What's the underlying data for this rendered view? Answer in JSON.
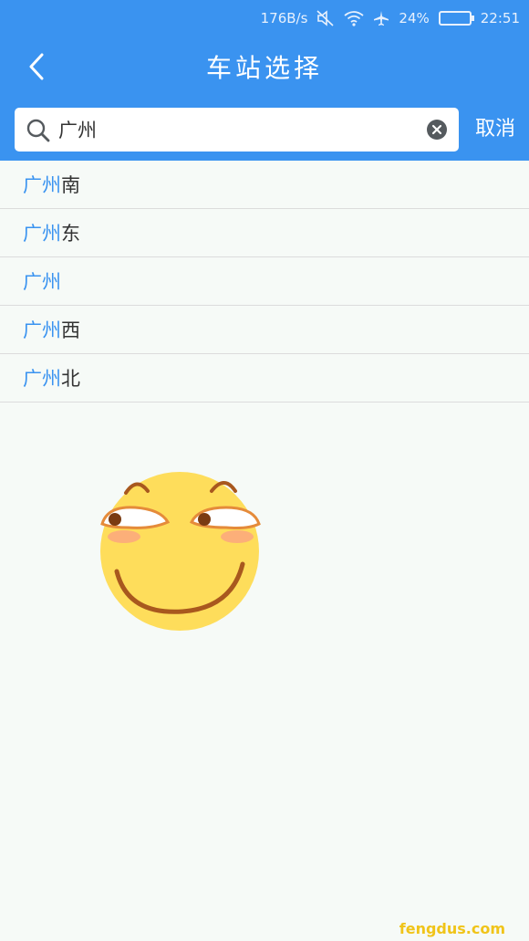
{
  "status_bar": {
    "speed": "176B/s",
    "battery": "24%",
    "time": "22:51",
    "icons": [
      "mute-icon",
      "wifi-icon",
      "airplane-icon",
      "battery-icon"
    ]
  },
  "header": {
    "title": "车站选择",
    "back_icon": "chevron-left-icon",
    "color": "#3a93f0"
  },
  "search": {
    "value": "广州",
    "placeholder": "",
    "cancel_label": "取消"
  },
  "results": [
    {
      "match": "广州",
      "rest": "南"
    },
    {
      "match": "广州",
      "rest": "东"
    },
    {
      "match": "广州",
      "rest": ""
    },
    {
      "match": "广州",
      "rest": "西"
    },
    {
      "match": "广州",
      "rest": "北"
    }
  ],
  "watermark": "fengdus.com"
}
